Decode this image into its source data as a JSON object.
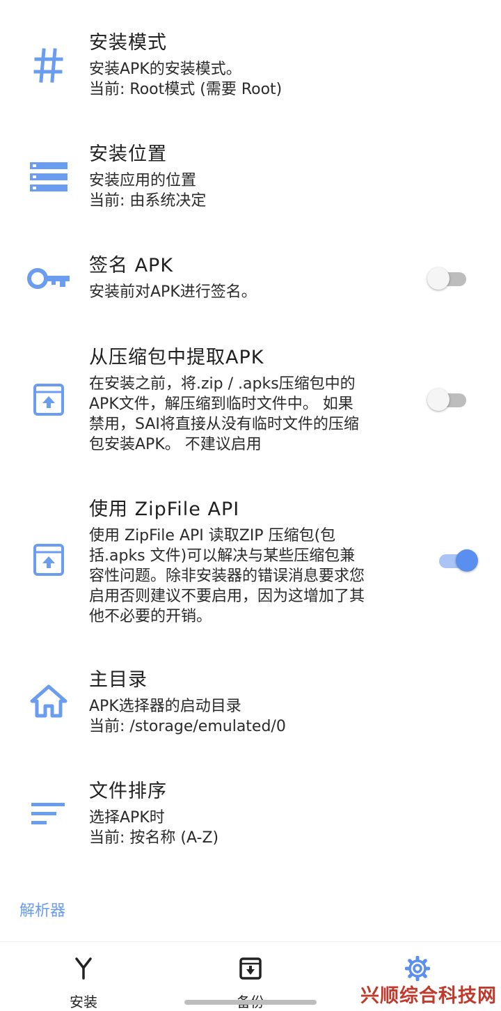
{
  "colors": {
    "accent": "#5b8fef",
    "icon": "#6a9cf0",
    "section_header": "#6a9cf0"
  },
  "preferences": [
    {
      "title": "安装模式",
      "lines": [
        "安装APK的安装模式。",
        "当前: Root模式 (需要 Root)"
      ],
      "icon": "hash-icon"
    },
    {
      "title": "安装位置",
      "lines": [
        "安装应用的位置",
        "当前: 由系统决定"
      ],
      "icon": "storage-icon"
    },
    {
      "title": "签名 APK",
      "lines": [
        "安装前对APK进行签名。"
      ],
      "icon": "key-icon",
      "toggle": false
    },
    {
      "title": "从压缩包中提取APK",
      "lines": [
        "在安装之前，将.zip / .apks压缩包中的",
        "APK文件，解压缩到临时文件中。 如果",
        "禁用，SAI将直接从没有临时文件的压缩",
        "包安装APK。 不建议启用"
      ],
      "icon": "archive-upload-icon",
      "toggle": false
    },
    {
      "title": "使用 ZipFile API",
      "lines": [
        "使用 ZipFile API 读取ZIP 压缩包(包",
        "括.apks 文件)可以解决与某些压缩包兼",
        "容性问题。除非安装器的错误消息要求您",
        "启用否则建议不要启用，因为这增加了其",
        "他不必要的开销。"
      ],
      "icon": "archive-upload-icon",
      "toggle": true
    },
    {
      "title": "主目录",
      "lines": [
        "APK选择器的启动目录",
        "当前: /storage/emulated/0"
      ],
      "icon": "home-icon"
    },
    {
      "title": "文件排序",
      "lines": [
        "选择APK时",
        "当前: 按名称 (A-Z)"
      ],
      "icon": "sort-icon"
    }
  ],
  "section_header": "解析器",
  "bottom_nav": [
    {
      "label": "安装",
      "icon": "install-icon"
    },
    {
      "label": "备份",
      "icon": "backup-icon"
    },
    {
      "label": "",
      "icon": "settings-icon",
      "active": true
    }
  ],
  "watermark": "兴顺综合科技网"
}
